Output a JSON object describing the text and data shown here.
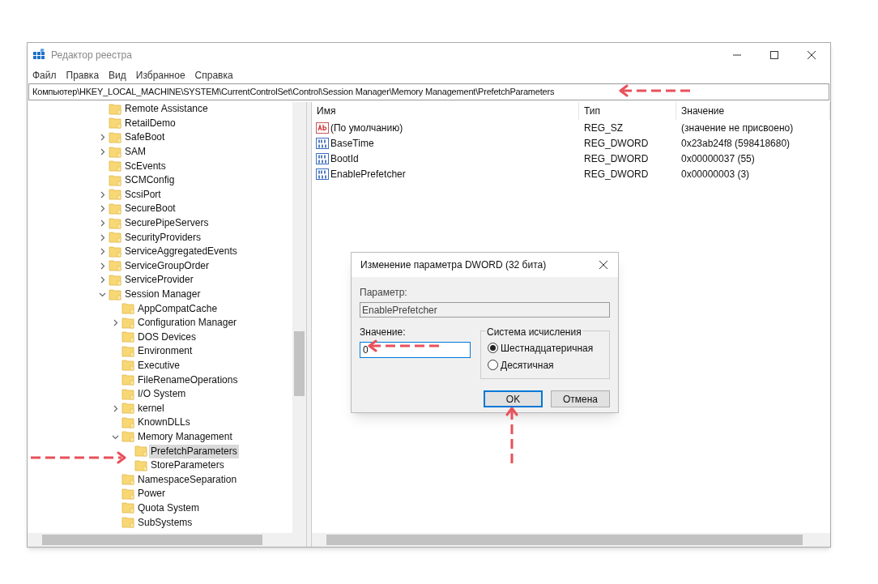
{
  "window": {
    "title": "Редактор реестра"
  },
  "menu": [
    "Файл",
    "Правка",
    "Вид",
    "Избранное",
    "Справка"
  ],
  "address": "Компьютер\\HKEY_LOCAL_MACHINE\\SYSTEM\\CurrentControlSet\\Control\\Session Manager\\Memory Management\\PrefetchParameters",
  "tree": [
    {
      "label": "Remote Assistance",
      "kind": "leaf",
      "selected": false
    },
    {
      "label": "RetailDemo",
      "kind": "leaf",
      "selected": false
    },
    {
      "label": "SafeBoot",
      "kind": "branch",
      "expanded": false,
      "selected": false
    },
    {
      "label": "SAM",
      "kind": "branch",
      "expanded": false,
      "selected": false
    },
    {
      "label": "ScEvents",
      "kind": "leaf",
      "selected": false
    },
    {
      "label": "SCMConfig",
      "kind": "leaf",
      "selected": false
    },
    {
      "label": "ScsiPort",
      "kind": "branch",
      "expanded": false,
      "selected": false
    },
    {
      "label": "SecureBoot",
      "kind": "branch",
      "expanded": false,
      "selected": false
    },
    {
      "label": "SecurePipeServers",
      "kind": "branch",
      "expanded": false,
      "selected": false
    },
    {
      "label": "SecurityProviders",
      "kind": "branch",
      "expanded": false,
      "selected": false
    },
    {
      "label": "ServiceAggregatedEvents",
      "kind": "branch",
      "expanded": false,
      "selected": false
    },
    {
      "label": "ServiceGroupOrder",
      "kind": "branch",
      "expanded": false,
      "selected": false
    },
    {
      "label": "ServiceProvider",
      "kind": "branch",
      "expanded": false,
      "selected": false
    },
    {
      "label": "Session Manager",
      "kind": "branch",
      "expanded": true,
      "selected": false,
      "children": [
        {
          "label": "AppCompatCache",
          "kind": "leaf",
          "selected": false
        },
        {
          "label": "Configuration Manager",
          "kind": "branch",
          "expanded": false,
          "selected": false
        },
        {
          "label": "DOS Devices",
          "kind": "leaf",
          "selected": false
        },
        {
          "label": "Environment",
          "kind": "leaf",
          "selected": false
        },
        {
          "label": "Executive",
          "kind": "leaf",
          "selected": false
        },
        {
          "label": "FileRenameOperations",
          "kind": "leaf",
          "selected": false
        },
        {
          "label": "I/O System",
          "kind": "leaf",
          "selected": false
        },
        {
          "label": "kernel",
          "kind": "branch",
          "expanded": false,
          "selected": false
        },
        {
          "label": "KnownDLLs",
          "kind": "leaf",
          "selected": false
        },
        {
          "label": "Memory Management",
          "kind": "branch",
          "expanded": true,
          "selected": false,
          "children": [
            {
              "label": "PrefetchParameters",
              "kind": "leaf",
              "selected": true
            },
            {
              "label": "StoreParameters",
              "kind": "leaf",
              "selected": false
            }
          ]
        },
        {
          "label": "NamespaceSeparation",
          "kind": "leaf",
          "selected": false
        },
        {
          "label": "Power",
          "kind": "leaf",
          "selected": false
        },
        {
          "label": "Quota System",
          "kind": "leaf",
          "selected": false
        },
        {
          "label": "SubSystems",
          "kind": "leaf",
          "selected": false
        }
      ]
    }
  ],
  "values": {
    "columns": [
      "Имя",
      "Тип",
      "Значение"
    ],
    "rows": [
      {
        "kind": "string",
        "name": "(По умолчанию)",
        "type": "REG_SZ",
        "value": "(значение не присвоено)"
      },
      {
        "kind": "dword",
        "name": "BaseTime",
        "type": "REG_DWORD",
        "value": "0x23ab24f8 (598418680)"
      },
      {
        "kind": "dword",
        "name": "BootId",
        "type": "REG_DWORD",
        "value": "0x00000037 (55)"
      },
      {
        "kind": "dword",
        "name": "EnablePrefetcher",
        "type": "REG_DWORD",
        "value": "0x00000003 (3)"
      }
    ]
  },
  "dialog": {
    "title": "Изменение параметра DWORD (32 бита)",
    "name_label": "Параметр:",
    "name_value": "EnablePrefetcher",
    "value_label": "Значение:",
    "value": "0",
    "base_group": "Система исчисления",
    "bases": [
      {
        "label": "Шестнадцатеричная",
        "selected": true
      },
      {
        "label": "Десятичная",
        "selected": false
      }
    ],
    "buttons": [
      {
        "label": "OK",
        "default": true
      },
      {
        "label": "Отмена",
        "default": false
      }
    ]
  }
}
